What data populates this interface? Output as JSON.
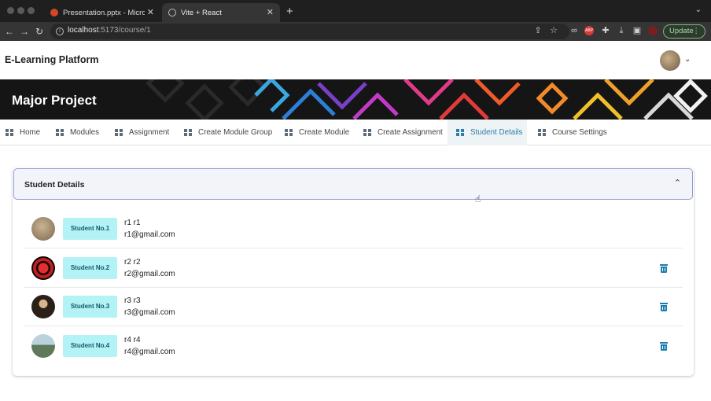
{
  "browser": {
    "tabs": [
      {
        "title": "Presentation.pptx - Microsoft Po",
        "close": "✕"
      },
      {
        "title": "Vite + React",
        "close": "✕"
      }
    ],
    "new_tab": "+",
    "url_host": "localhost",
    "url_path": ":5173/course/1",
    "update_label": "Update"
  },
  "app": {
    "brand": "E-Learning Platform",
    "banner_title": "Major Project"
  },
  "nav": {
    "items": [
      {
        "label": "Home"
      },
      {
        "label": "Modules"
      },
      {
        "label": "Assignment"
      },
      {
        "label": "Create Module Group"
      },
      {
        "label": "Create Module"
      },
      {
        "label": "Create Assignment"
      },
      {
        "label": "Student Details",
        "active": true
      },
      {
        "label": "Course Settings"
      }
    ]
  },
  "panel": {
    "title": "Student Details",
    "students": [
      {
        "badge": "Student No.1",
        "name": "r1 r1",
        "email": "r1@gmail.com"
      },
      {
        "badge": "Student No.2",
        "name": "r2 r2",
        "email": "r2@gmail.com"
      },
      {
        "badge": "Student No.3",
        "name": "r3 r3",
        "email": "r3@gmail.com"
      },
      {
        "badge": "Student No.4",
        "name": "r4 r4",
        "email": "r4@gmail.com"
      }
    ]
  },
  "colors": {
    "accent": "#2e7ea6",
    "badge_bg": "#b3f3f6",
    "delete_icon": "#1a7fb0"
  }
}
